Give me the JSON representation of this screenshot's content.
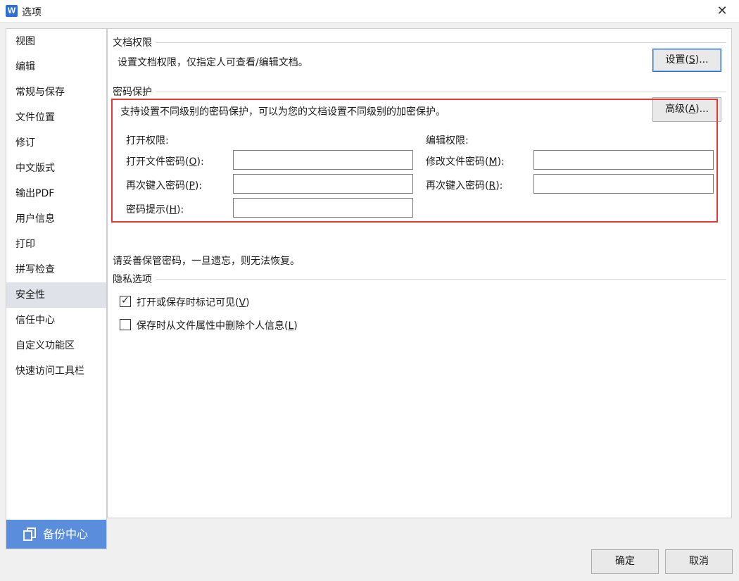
{
  "window": {
    "title": "选项",
    "app_icon_letter": "W",
    "app_icon_color": "#2e6ed9",
    "close_glyph": "✕"
  },
  "sidebar": {
    "items": [
      {
        "label": "视图"
      },
      {
        "label": "编辑"
      },
      {
        "label": "常规与保存"
      },
      {
        "label": "文件位置"
      },
      {
        "label": "修订"
      },
      {
        "label": "中文版式"
      },
      {
        "label": "输出PDF"
      },
      {
        "label": "用户信息"
      },
      {
        "label": "打印"
      },
      {
        "label": "拼写检查"
      },
      {
        "label": "安全性",
        "active": true
      },
      {
        "label": "信任中心"
      },
      {
        "label": "自定义功能区"
      },
      {
        "label": "快速访问工具栏"
      }
    ],
    "backup": {
      "label": "备份中心",
      "color": "#5b8ddd"
    }
  },
  "doc_permissions": {
    "title": "文档权限",
    "description": "设置文档权限，仅指定人可查看/编辑文档。",
    "settings_button": {
      "prefix": "设置(",
      "key": "S",
      "suffix": ")..."
    }
  },
  "password": {
    "title": "密码保护",
    "description": "支持设置不同级别的密码保护，可以为您的文档设置不同级别的加密保护。",
    "advanced_button": {
      "prefix": "高级(",
      "key": "A",
      "suffix": ")..."
    },
    "open": {
      "heading": "打开权限:",
      "password": {
        "prefix": "打开文件密码(",
        "key": "O",
        "suffix": "):",
        "value": ""
      },
      "confirm": {
        "prefix": "再次键入密码(",
        "key": "P",
        "suffix": "):",
        "value": ""
      },
      "hint": {
        "prefix": "密码提示(",
        "key": "H",
        "suffix": "):",
        "value": ""
      }
    },
    "edit": {
      "heading": "编辑权限:",
      "password": {
        "prefix": "修改文件密码(",
        "key": "M",
        "suffix": "):",
        "value": ""
      },
      "confirm": {
        "prefix": "再次键入密码(",
        "key": "R",
        "suffix": "):",
        "value": ""
      }
    },
    "warning": "请妥善保管密码，一旦遗忘，则无法恢复。",
    "highlight_color": "#e53935"
  },
  "privacy": {
    "title": "隐私选项",
    "options": [
      {
        "prefix": "打开或保存时标记可见(",
        "key": "V",
        "suffix": ")",
        "checked": true
      },
      {
        "prefix": "保存时从文件属性中删除个人信息(",
        "key": "L",
        "suffix": ")",
        "checked": false
      }
    ],
    "check_glyph": "✓"
  },
  "footer": {
    "ok_label": "确定",
    "cancel_label": "取消"
  }
}
